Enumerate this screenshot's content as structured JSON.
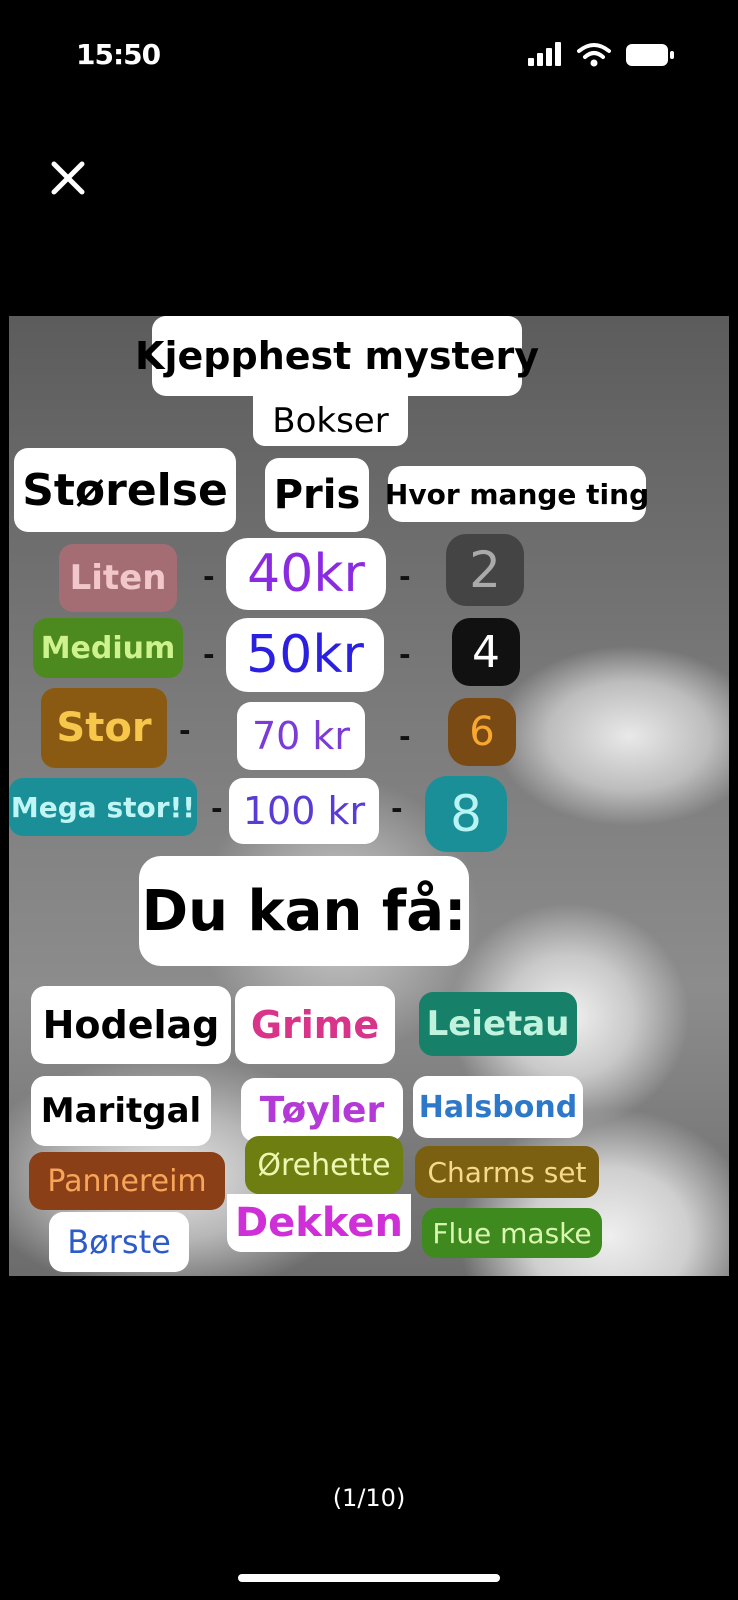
{
  "status": {
    "time": "15:50"
  },
  "viewer": {
    "counter": "(1/10)"
  },
  "poster": {
    "title": "Kjepphest mystery",
    "subtitle": "Bokser",
    "headers": {
      "size": "Størelse",
      "price": "Pris",
      "count": "Hvor mange ting"
    },
    "rows": [
      {
        "size": "Liten",
        "price": "40kr",
        "count": "2"
      },
      {
        "size": "Medium",
        "price": "50kr",
        "count": "4"
      },
      {
        "size": "Stor",
        "price": "70 kr",
        "count": "6"
      },
      {
        "size": "Mega stor!!",
        "price": "100 kr",
        "count": "8"
      }
    ],
    "dash": "-",
    "you_get": "Du kan få:",
    "items": [
      "Hodelag",
      "Grime",
      "Leietau",
      "Maritgal",
      "Tøyler",
      "Halsbond",
      "Pannereim",
      "Ørehette",
      "Charms set",
      "Dekken",
      "Børste",
      "Flue maske"
    ]
  },
  "colors": {
    "liten": "#a46d74",
    "medium": "#4c8a1f",
    "stor": "#8a5a12",
    "mega": "#1b8f98",
    "purple": "#8a2be2",
    "blue": "#2b1fe0",
    "pink": "#d8348a",
    "teal": "#178068",
    "brown": "#8a3f16",
    "olive": "#6e7e10",
    "green": "#3f8a1f"
  }
}
